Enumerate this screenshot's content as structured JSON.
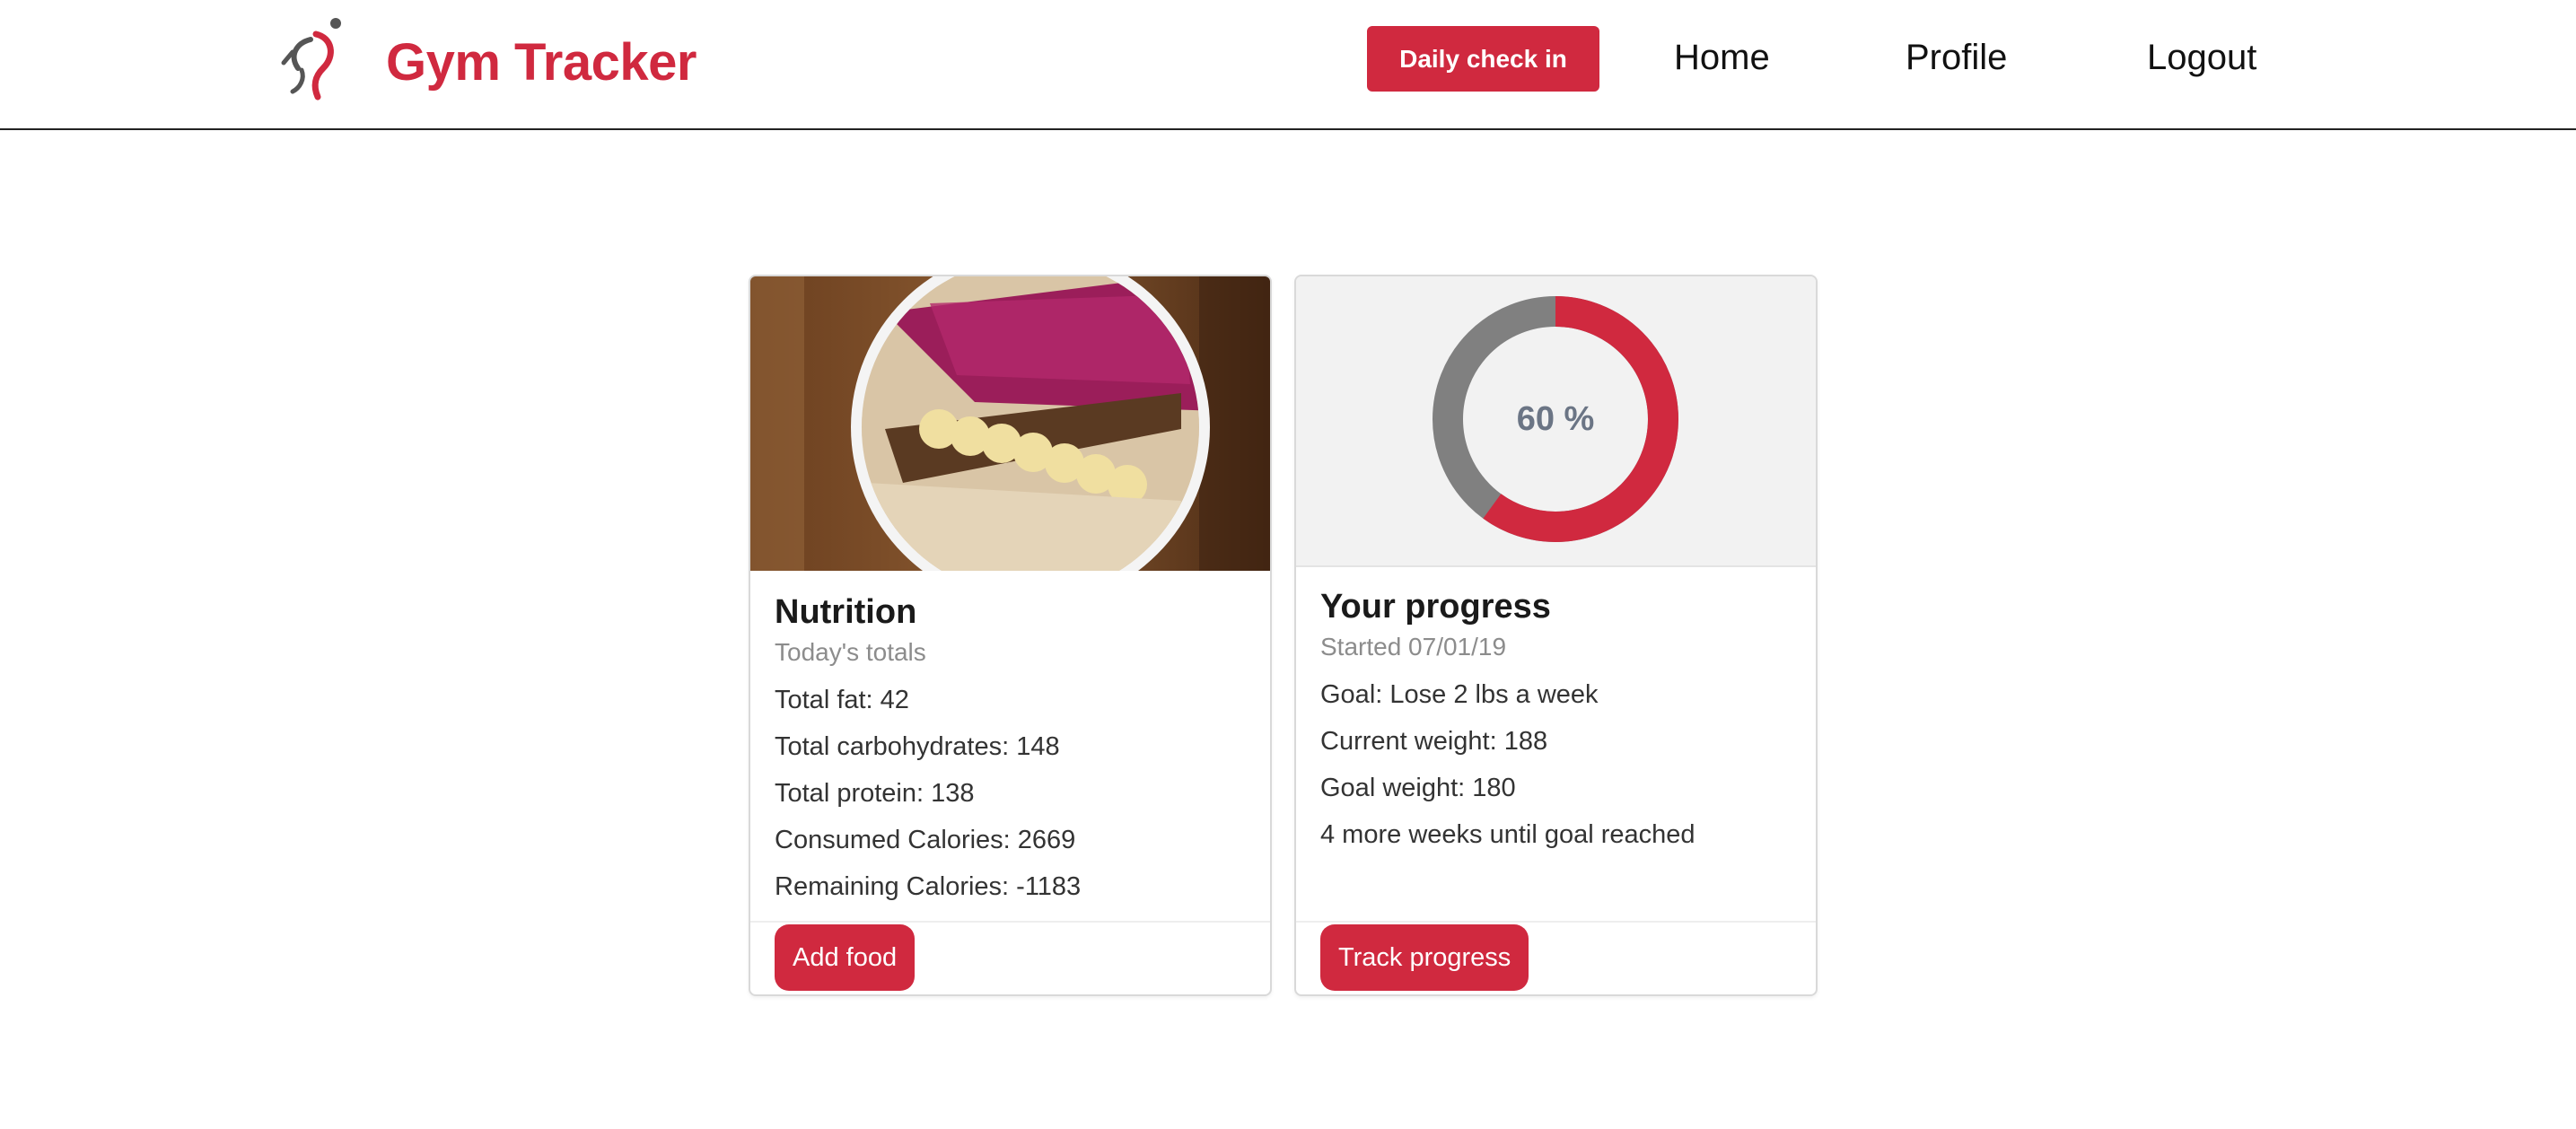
{
  "brand": {
    "name": "Gym Tracker",
    "logo_icon": "runner-icon"
  },
  "nav": {
    "checkin_label": "Daily check in",
    "links": [
      "Home",
      "Profile",
      "Logout"
    ]
  },
  "colors": {
    "accent": "#d0293f",
    "donut_track": "#808080",
    "donut_text": "#6b7585"
  },
  "nutrition": {
    "image": "acai-bowl-photo",
    "title": "Nutrition",
    "subtitle": "Today's totals",
    "lines": [
      "Total fat: 42",
      "Total carbohydrates: 148",
      "Total protein: 138",
      "Consumed Calories: 2669",
      "Remaining Calories: -1183"
    ],
    "button_label": "Add food"
  },
  "progress": {
    "percent_value": 0.6,
    "percent_label": "60 %",
    "title": "Your progress",
    "subtitle": "Started 07/01/19",
    "lines": [
      "Goal: Lose 2 lbs a week",
      "Current weight: 188",
      "Goal weight: 180",
      "4 more weeks until goal reached"
    ],
    "button_label": "Track progress"
  }
}
